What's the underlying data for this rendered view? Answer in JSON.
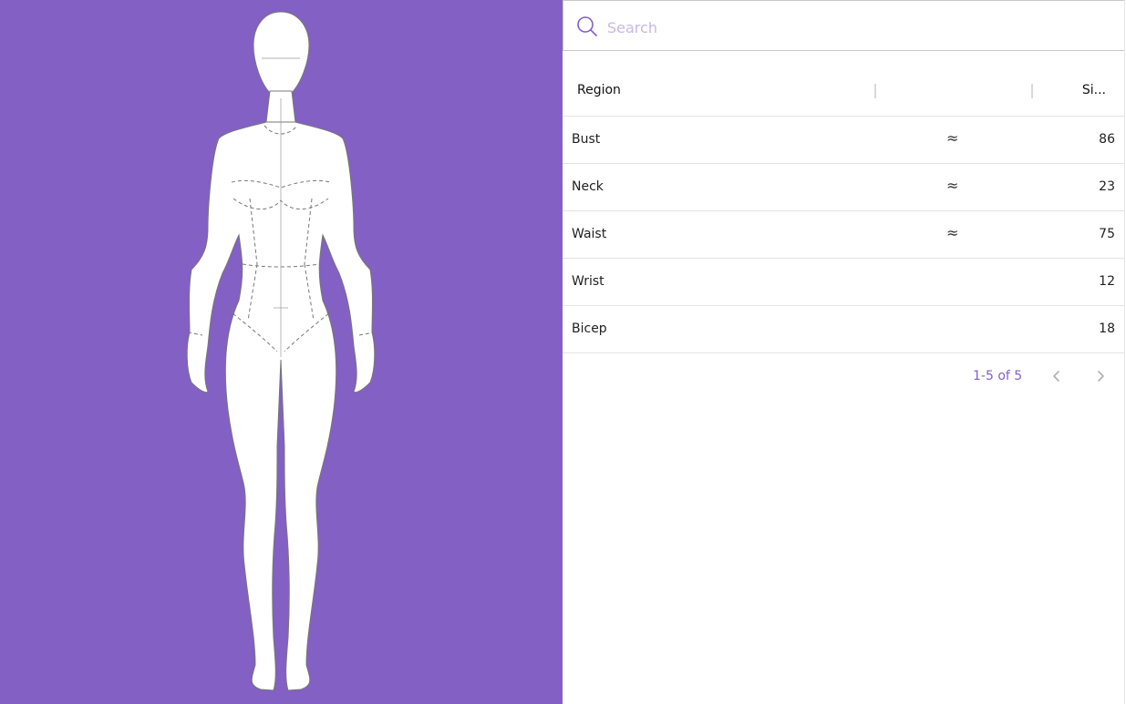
{
  "colors": {
    "accent": "#8360c3",
    "figure_fill": "#ffffff",
    "figure_outline": "#777777"
  },
  "search": {
    "placeholder": "Search",
    "value": ""
  },
  "table": {
    "headers": {
      "region": "Region",
      "icon": "",
      "size": "Si..."
    },
    "rows": [
      {
        "region": "Bust",
        "approx": "≈",
        "size": "86"
      },
      {
        "region": "Neck",
        "approx": "≈",
        "size": "23"
      },
      {
        "region": "Waist",
        "approx": "≈",
        "size": "75"
      },
      {
        "region": "Wrist",
        "approx": "",
        "size": "12"
      },
      {
        "region": "Bicep",
        "approx": "",
        "size": "18"
      }
    ]
  },
  "pagination": {
    "label": "1-5 of 5"
  },
  "icons": {
    "search": "search-icon",
    "prev": "chevron-left-icon",
    "next": "chevron-right-icon",
    "figure": "fashion-croquis-figure"
  }
}
